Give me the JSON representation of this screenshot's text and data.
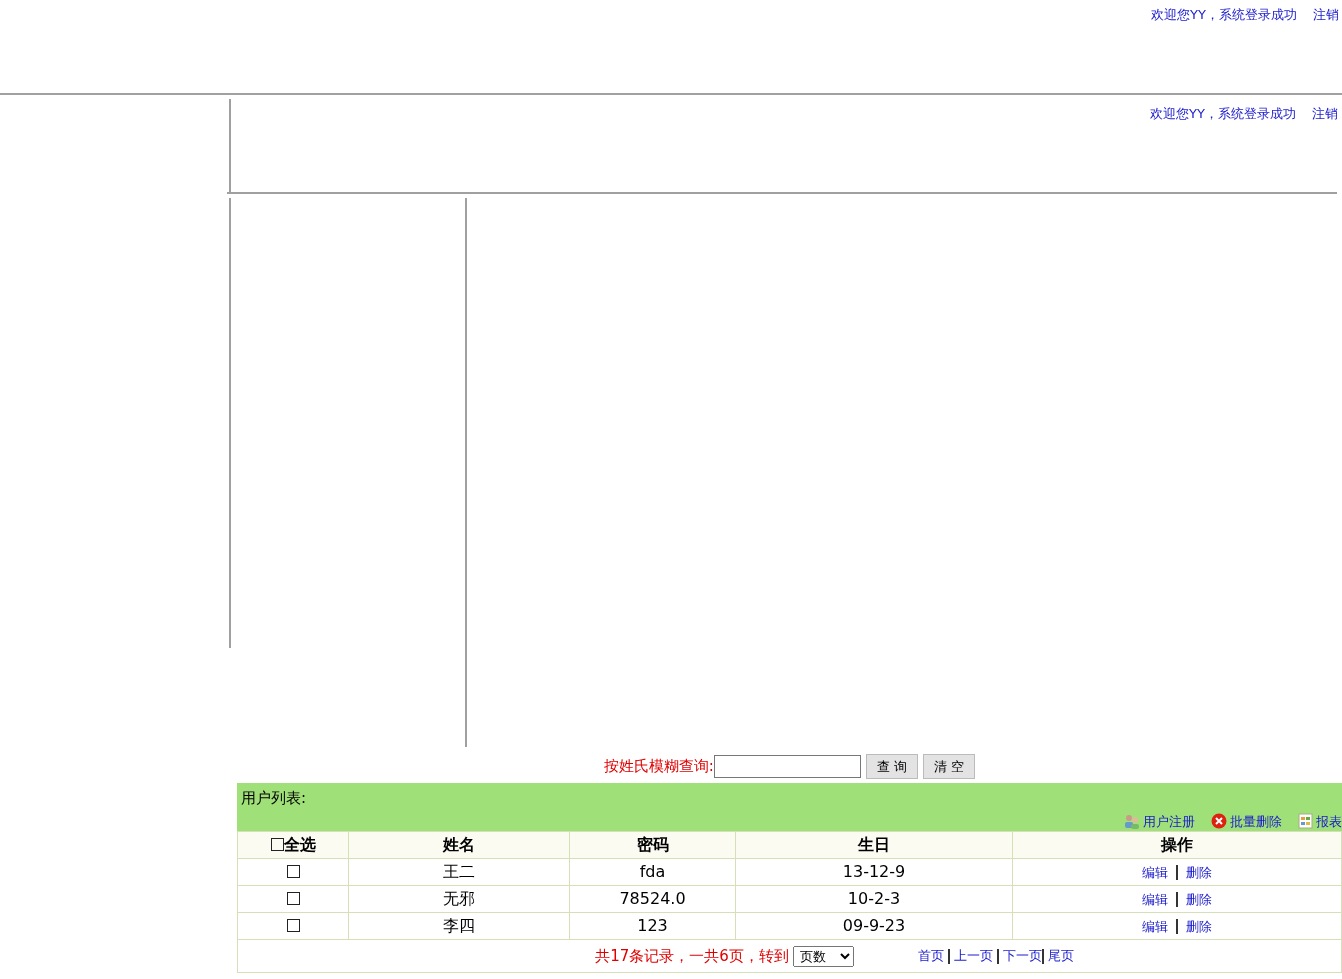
{
  "top_header": {
    "welcome": "欢迎您YY，系统登录成功",
    "logout": "注销"
  },
  "inner_header": {
    "welcome": "欢迎您YY，系统登录成功",
    "logout": "注销"
  },
  "search": {
    "label": "按姓氏模糊查询:",
    "buttons": [
      "查 询",
      "清 空"
    ]
  },
  "user_list": {
    "title": "用户列表:",
    "toolbar": [
      {
        "kind": "users",
        "label": "用户注册"
      },
      {
        "kind": "delete",
        "label": "批量删除"
      },
      {
        "kind": "report",
        "label": "报表"
      }
    ],
    "columns": [
      {
        "kind": "select",
        "label": "全选",
        "checked": false
      },
      {
        "kind": "text",
        "label": "姓名"
      },
      {
        "kind": "text",
        "label": "密码"
      },
      {
        "kind": "text",
        "label": "生日"
      },
      {
        "kind": "actions",
        "label": "操作"
      }
    ],
    "rows": [
      {
        "checked": false,
        "name": "王二",
        "password": "fda",
        "birthday": "13-12-9",
        "actions": [
          "编辑",
          "删除"
        ]
      },
      {
        "checked": false,
        "name": "无邪",
        "password": "78524.0",
        "birthday": "10-2-3",
        "actions": [
          "编辑",
          "删除"
        ]
      },
      {
        "checked": false,
        "name": "李四",
        "password": "123",
        "birthday": "09-9-23",
        "actions": [
          "编辑",
          "删除"
        ]
      }
    ],
    "pager": {
      "summary": "共17条记录，一共6页，转到",
      "page_select": "页数",
      "links": [
        "首页",
        "上一页",
        "下一页",
        "尾页"
      ]
    }
  }
}
